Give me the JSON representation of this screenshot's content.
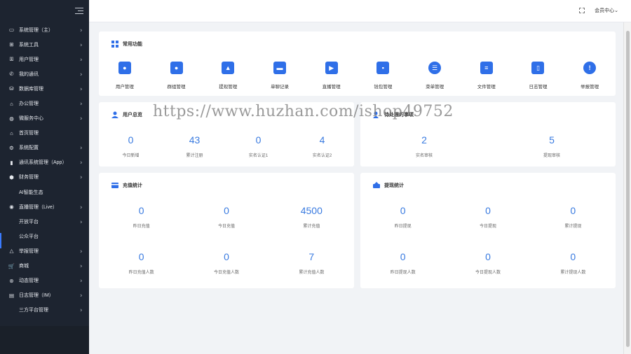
{
  "sidebar": {
    "items": [
      {
        "label": "系统管理（主）",
        "icon": "monitor-icon",
        "glyph": "▭",
        "sub": false,
        "chevron": true
      },
      {
        "label": "系统工具",
        "icon": "grid-icon",
        "glyph": "⊞",
        "sub": false,
        "chevron": true
      },
      {
        "label": "用户管理",
        "icon": "users-icon",
        "glyph": "ꕥ",
        "sub": false,
        "chevron": true
      },
      {
        "label": "我的通讯",
        "icon": "phone-icon",
        "glyph": "✆",
        "sub": false,
        "chevron": true
      },
      {
        "label": "数据库管理",
        "icon": "database-icon",
        "glyph": "⛁",
        "sub": false,
        "chevron": true
      },
      {
        "label": "办公管理",
        "icon": "office-icon",
        "glyph": "⌂",
        "sub": false,
        "chevron": true
      },
      {
        "label": "微服务中心",
        "icon": "globe-icon",
        "glyph": "◍",
        "sub": false,
        "chevron": true
      },
      {
        "label": "首页管理",
        "icon": "home-icon",
        "glyph": "⌂",
        "sub": false,
        "chevron": false
      },
      {
        "label": "系统配置",
        "icon": "settings-icon",
        "glyph": "⚙",
        "sub": false,
        "chevron": true
      },
      {
        "label": "通讯系统管理（App）",
        "icon": "chart-icon",
        "glyph": "▮",
        "sub": false,
        "chevron": true
      },
      {
        "label": "财务管理",
        "icon": "finance-icon",
        "glyph": "⬢",
        "sub": false,
        "chevron": true
      },
      {
        "label": "AI智能生态",
        "icon": "",
        "glyph": "",
        "sub": true,
        "chevron": false
      },
      {
        "label": "直播管理（Live）",
        "icon": "live-icon",
        "glyph": "◉",
        "sub": false,
        "chevron": true
      },
      {
        "label": "开放平台",
        "icon": "",
        "glyph": "",
        "sub": true,
        "chevron": true
      },
      {
        "label": "公众平台",
        "icon": "",
        "glyph": "",
        "sub": true,
        "chevron": false
      },
      {
        "label": "举报管理",
        "icon": "warning-icon",
        "glyph": "△",
        "sub": false,
        "chevron": true
      },
      {
        "label": "商城",
        "icon": "cart-icon",
        "glyph": "🛒",
        "sub": false,
        "chevron": true
      },
      {
        "label": "动态管理",
        "icon": "dynamic-icon",
        "glyph": "⊛",
        "sub": false,
        "chevron": true
      },
      {
        "label": "日志管理（IM）",
        "icon": "log-icon",
        "glyph": "▤",
        "sub": false,
        "chevron": true
      },
      {
        "label": "三方平台管理",
        "icon": "",
        "glyph": "",
        "sub": true,
        "chevron": true
      }
    ]
  },
  "header": {
    "member_label": "会员中心",
    "member_caret": "⌄"
  },
  "quick": {
    "title": "常用功能",
    "items": [
      {
        "label": "用户管理",
        "icon": "user-manage-icon",
        "glyph": "●",
        "round": false
      },
      {
        "label": "群组管理",
        "icon": "group-manage-icon",
        "glyph": "●",
        "round": false
      },
      {
        "label": "提现管理",
        "icon": "withdraw-manage-icon",
        "glyph": "▲",
        "round": false
      },
      {
        "label": "单聊记录",
        "icon": "chat-record-icon",
        "glyph": "▬",
        "round": false
      },
      {
        "label": "直播管理",
        "icon": "live-manage-icon",
        "glyph": "▶",
        "round": false
      },
      {
        "label": "钱包管理",
        "icon": "wallet-manage-icon",
        "glyph": "▪",
        "round": false
      },
      {
        "label": "菜单管理",
        "icon": "menu-manage-icon",
        "glyph": "☰",
        "round": true
      },
      {
        "label": "文件管理",
        "icon": "file-manage-icon",
        "glyph": "≡",
        "round": false
      },
      {
        "label": "日志管理",
        "icon": "log-manage-icon",
        "glyph": "▯",
        "round": false
      },
      {
        "label": "举报管理",
        "icon": "report-manage-icon",
        "glyph": "!",
        "round": true
      }
    ]
  },
  "user_overview": {
    "title": "用户总览",
    "stats": [
      {
        "value": "0",
        "label": "今日新增"
      },
      {
        "value": "43",
        "label": "累计注册"
      },
      {
        "value": "0",
        "label": "实名认证1"
      },
      {
        "value": "4",
        "label": "实名认证2"
      }
    ]
  },
  "pending": {
    "title": "待处理的事项",
    "stats": [
      {
        "value": "2",
        "label": "实名审核"
      },
      {
        "value": "5",
        "label": "提现审核"
      }
    ]
  },
  "recharge": {
    "title": "充值统计",
    "row1": [
      {
        "value": "0",
        "label": "昨日充值"
      },
      {
        "value": "0",
        "label": "今日充值"
      },
      {
        "value": "4500",
        "label": "累计充值"
      }
    ],
    "row2": [
      {
        "value": "0",
        "label": "昨日充值人数"
      },
      {
        "value": "0",
        "label": "今日充值人数"
      },
      {
        "value": "7",
        "label": "累计充值人数"
      }
    ]
  },
  "withdraw": {
    "title": "提现统计",
    "row1": [
      {
        "value": "0",
        "label": "昨日提现"
      },
      {
        "value": "0",
        "label": "今日提现"
      },
      {
        "value": "0",
        "label": "累计提现"
      }
    ],
    "row2": [
      {
        "value": "0",
        "label": "昨日提现人数"
      },
      {
        "value": "0",
        "label": "今日提现人数"
      },
      {
        "value": "0",
        "label": "累计提现人数"
      }
    ]
  },
  "watermark": "https://www.huzhan.com/ishop49752",
  "colors": {
    "accent": "#2f6fe8",
    "number": "#3a7be0",
    "sidebar_bg": "#1d2430"
  }
}
